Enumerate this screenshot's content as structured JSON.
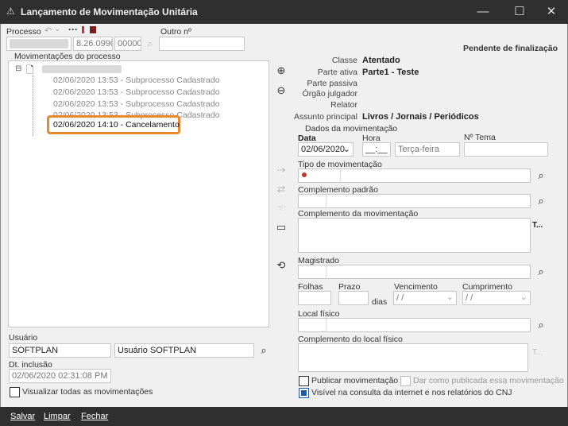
{
  "window": {
    "title": "Lançamento de Movimentação Unitária",
    "minimize": "—",
    "maximize": "☐",
    "close": "✕"
  },
  "processo": {
    "label": "Processo",
    "part1": "8.26.0990",
    "part2": "00000",
    "outro_label": "Outro nº",
    "outro_value": ""
  },
  "status": "Pendente de finalização",
  "movimentacoes": {
    "label": "Movimentações do processo",
    "items": [
      "02/06/2020 13:53 - Subprocesso Cadastrado",
      "02/06/2020 13:53 - Subprocesso Cadastrado",
      "02/06/2020 13:53 - Subprocesso Cadastrado",
      "02/06/2020 13:53 - Subprocesso Cadastrado",
      "02/06/2020 14:10 - Cancelamento"
    ]
  },
  "info": {
    "classe_label": "Classe",
    "classe_value": "Atentado",
    "parte_ativa_label": "Parte ativa",
    "parte_ativa_value": "Parte1 - Teste",
    "parte_passiva_label": "Parte passiva",
    "orgao_label": "Órgão julgador",
    "relator_label": "Relator",
    "assunto_label": "Assunto principal",
    "assunto_value": "Livros / Jornais / Periódicos"
  },
  "dados": {
    "group_label": "Dados da movimentação",
    "data_label": "Data",
    "data_value": "02/06/2020",
    "hora_label": "Hora",
    "hora_value": "__:__",
    "dia_semana": "Terça-feira",
    "tema_label": "Nº Tema",
    "tema_value": "",
    "tipo_label": "Tipo de movimentação",
    "complemento_padrao_label": "Complemento padrão",
    "complemento_mov_label": "Complemento da movimentação",
    "complemento_mov_btn": "T...",
    "magistrado_label": "Magistrado",
    "folhas_label": "Folhas",
    "prazo_label": "Prazo",
    "dias_label": "dias",
    "vencimento_label": "Vencimento",
    "vencimento_value": "/ /",
    "cumprimento_label": "Cumprimento",
    "cumprimento_value": "/ /",
    "local_fisico_label": "Local físico",
    "complemento_local_label": "Complemento do local físico",
    "complemento_local_btn": "T...",
    "publicar_label": "Publicar movimentação",
    "dar_como_label": "Dar como publicada essa movimentação",
    "visivel_label": "Visível na consulta da internet e nos relatórios do CNJ"
  },
  "usuario": {
    "label": "Usuário",
    "login": "SOFTPLAN",
    "nome": "Usuário SOFTPLAN"
  },
  "inclusao": {
    "label": "Dt. inclusão",
    "value": "02/06/2020 02:31:08 PM"
  },
  "visualizar_label": "Visualizar todas as movimentações",
  "footer": {
    "salvar": "Salvar",
    "limpar": "Limpar",
    "fechar": "Fechar"
  }
}
